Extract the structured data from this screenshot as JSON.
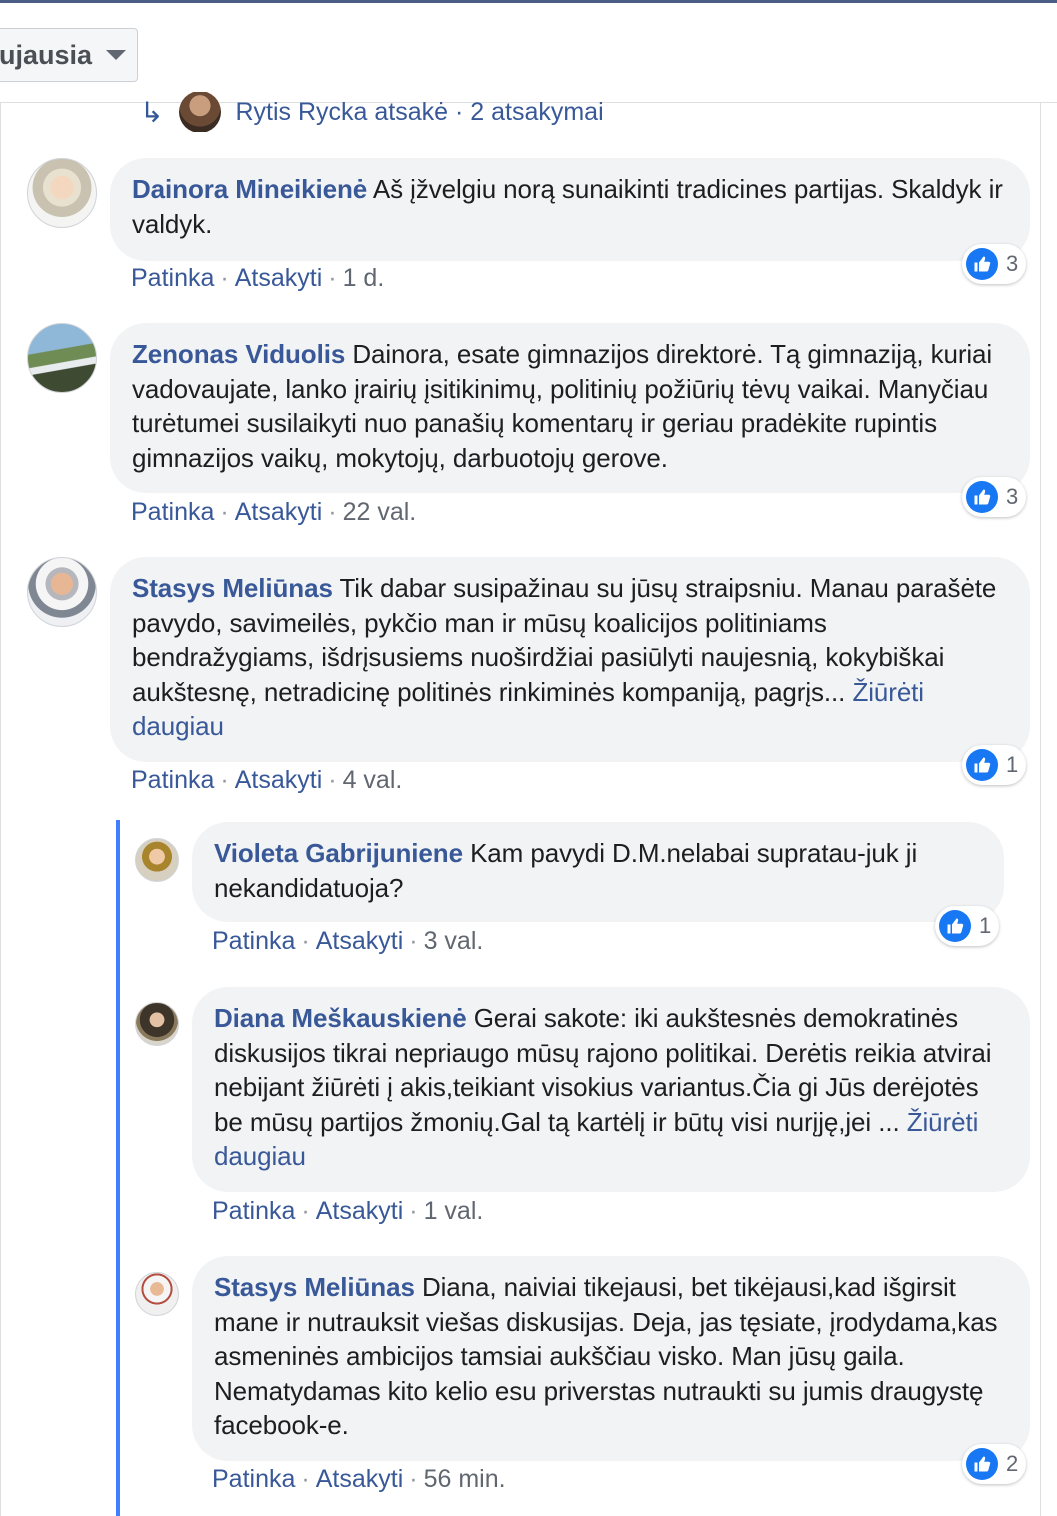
{
  "sort": {
    "label": "ujausia"
  },
  "reply_summary": {
    "text": "Rytis Rycka atsakė · 2 atsakymai"
  },
  "actions": {
    "like": "Patinka",
    "reply": "Atsakyti",
    "sep": "·"
  },
  "comments": [
    {
      "author": "Dainora Mineikienė",
      "text": "Aš įžvelgiu norą sunaikinti tradicines partijas. Skaldyk ir valdyk.",
      "time": "1 d.",
      "likes": "3"
    },
    {
      "author": "Zenonas Viduolis",
      "text": "Dainora, esate gimnazijos direktorė. Tą gimnaziją, kuriai vadovaujate, lanko įrairių įsitikinimų, politinių požiūrių tėvų vaikai. Manyčiau turėtumei susilaikyti nuo panašių komentarų ir geriau pradėkite rupintis gimnazijos vaikų, mokytojų, darbuotojų gerove.",
      "time": "22 val.",
      "likes": "3"
    },
    {
      "author": "Stasys Meliūnas",
      "text": "Tik dabar susipažinau su jūsų straipsniu. Manau parašėte pavydo, savimeilės, pykčio man ir mūsų koalicijos politiniams bendražygiams, išdrįsusiems nuoširdžiai pasiūlyti naujesnią, kokybiškai aukštesnę, netradicinę politinės rinkiminės kompaniją, pagrįs...",
      "see_more": "Žiūrėti daugiau",
      "time": "4 val.",
      "likes": "1"
    }
  ],
  "replies": [
    {
      "author": "Violeta Gabrijuniene",
      "text": "Kam pavydi D.M.nelabai supratau-juk ji nekandidatuoja?",
      "time": "3 val.",
      "likes": "1"
    },
    {
      "author": "Diana Meškauskienė",
      "text": "Gerai sakote: iki aukštesnės demokratinės diskusijos tikrai nepriaugo mūsų rajono politikai. Derėtis reikia atvirai nebijant žiūrėti į akis,teikiant visokius variantus.Čia gi Jūs derėjotės be mūsų partijos žmonių.Gal tą kartėlį ir būtų visi nurįję,jei ...",
      "see_more": "Žiūrėti daugiau",
      "time": "1 val."
    },
    {
      "author": "Stasys Meliūnas",
      "text": "Diana, naiviai tikejausi, bet tikėjausi,kad išgirsit mane ir nutrauksit viešas diskusijas. Deja, jas tęsiate, įrodydama,kas asmeninės ambicijos tamsiai aukščiau visko. Man jūsų gaila. Nematydamas kito kelio esu priverstas nutraukti su jumis draugystę facebook-e.",
      "time": "56 min.",
      "likes": "2"
    }
  ],
  "colors": {
    "link": "#385898",
    "bubble": "#f2f3f5",
    "like_blue": "#1877f2",
    "thread_line": "#4080ff"
  },
  "icons": {
    "reply_arrow": "reply-arrow-icon",
    "like": "thumbs-up-icon",
    "caret": "chevron-down-icon"
  }
}
